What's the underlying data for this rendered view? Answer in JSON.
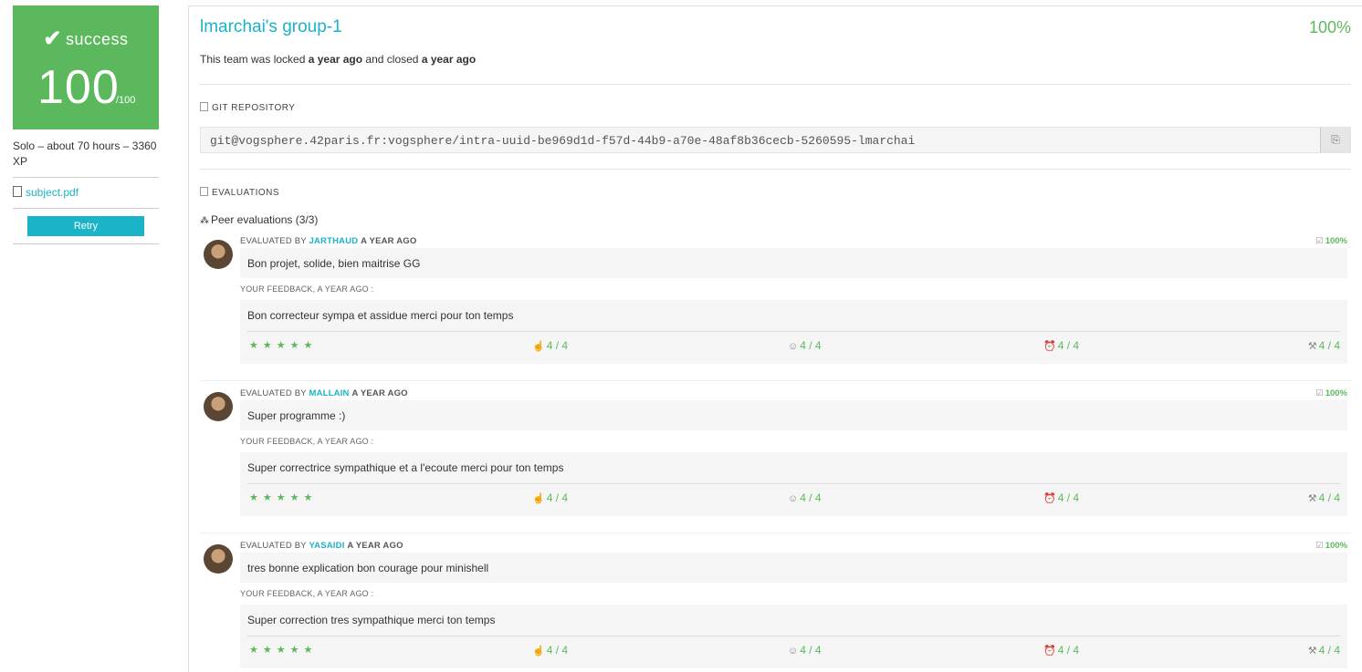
{
  "sidebar": {
    "status": "success",
    "score": "100",
    "score_max": "/100",
    "info": "Solo – about 70 hours – 3360 XP",
    "file_link": "subject.pdf",
    "retry_label": "Retry",
    "accent": "#5cb85c"
  },
  "team": {
    "title": "lmarchai's group-1",
    "percent": "100%",
    "status_prefix": "This team was locked ",
    "locked_when": "a year ago",
    "status_mid": " and closed ",
    "closed_when": "a year ago"
  },
  "git": {
    "label": "GIT REPOSITORY",
    "url": "git@vogsphere.42paris.fr:vogsphere/intra-uuid-be969d1d-f57d-44b9-a70e-48af8b36cecb-5260595-lmarchai"
  },
  "evaluations": {
    "label": "EVALUATIONS",
    "peer_title": "Peer evaluations (3/3)",
    "evaluated_by": "EVALUATED BY",
    "feedback_label": "YOUR FEEDBACK, A YEAR AGO :",
    "items": [
      {
        "login": "JARTHAUD",
        "ago": "A YEAR AGO",
        "percent": "100%",
        "comment": "Bon projet, solide, bien maitrise GG",
        "feedback": "Bon correcteur sympa et assidue merci pour ton temps",
        "stars": "★★★★★",
        "ratings": [
          "4 / 4",
          "4 / 4",
          "4 / 4",
          "4 / 4"
        ]
      },
      {
        "login": "MALLAIN",
        "ago": "A YEAR AGO",
        "percent": "100%",
        "comment": "Super programme :)",
        "feedback": "Super correctrice sympathique et a l'ecoute merci pour ton temps",
        "stars": "★★★★★",
        "ratings": [
          "4 / 4",
          "4 / 4",
          "4 / 4",
          "4 / 4"
        ]
      },
      {
        "login": "YASAIDI",
        "ago": "A YEAR AGO",
        "percent": "100%",
        "comment": "tres bonne explication bon courage pour minishell",
        "feedback": "Super correction tres sympathique merci ton temps",
        "stars": "★★★★★",
        "ratings": [
          "4 / 4",
          "4 / 4",
          "4 / 4",
          "4 / 4"
        ]
      }
    ]
  }
}
